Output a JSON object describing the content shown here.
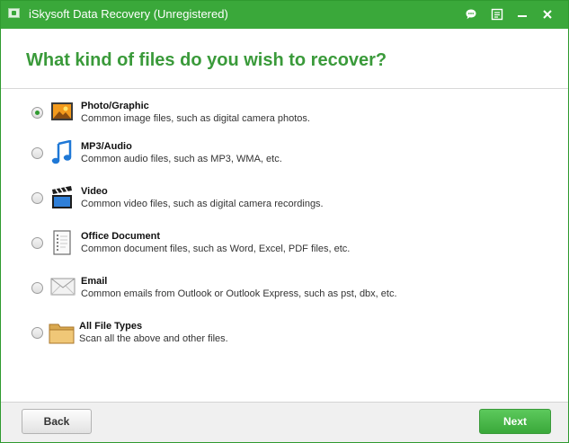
{
  "window": {
    "title": "iSkysoft Data Recovery (Unregistered)"
  },
  "header": {
    "heading": "What kind of files do you wish to recover?"
  },
  "options": [
    {
      "title": "Photo/Graphic",
      "desc": "Common image files, such as digital camera photos.",
      "icon": "photo-icon",
      "selected": true
    },
    {
      "title": "MP3/Audio",
      "desc": "Common audio files, such as MP3, WMA, etc.",
      "icon": "music-note-icon",
      "selected": false
    },
    {
      "title": "Video",
      "desc": "Common video files, such as digital camera recordings.",
      "icon": "clapperboard-icon",
      "selected": false
    },
    {
      "title": "Office Document",
      "desc": "Common document files, such as Word, Excel, PDF files, etc.",
      "icon": "document-icon",
      "selected": false
    },
    {
      "title": "Email",
      "desc": "Common emails from Outlook or Outlook Express, such as pst, dbx, etc.",
      "icon": "envelope-icon",
      "selected": false
    },
    {
      "title": "All File Types",
      "desc": "Scan all the above and other files.",
      "icon": "folder-icon",
      "selected": false
    }
  ],
  "footer": {
    "back_label": "Back",
    "next_label": "Next"
  },
  "colors": {
    "brand_green": "#3aa83a",
    "heading_green": "#3a9a3a"
  }
}
